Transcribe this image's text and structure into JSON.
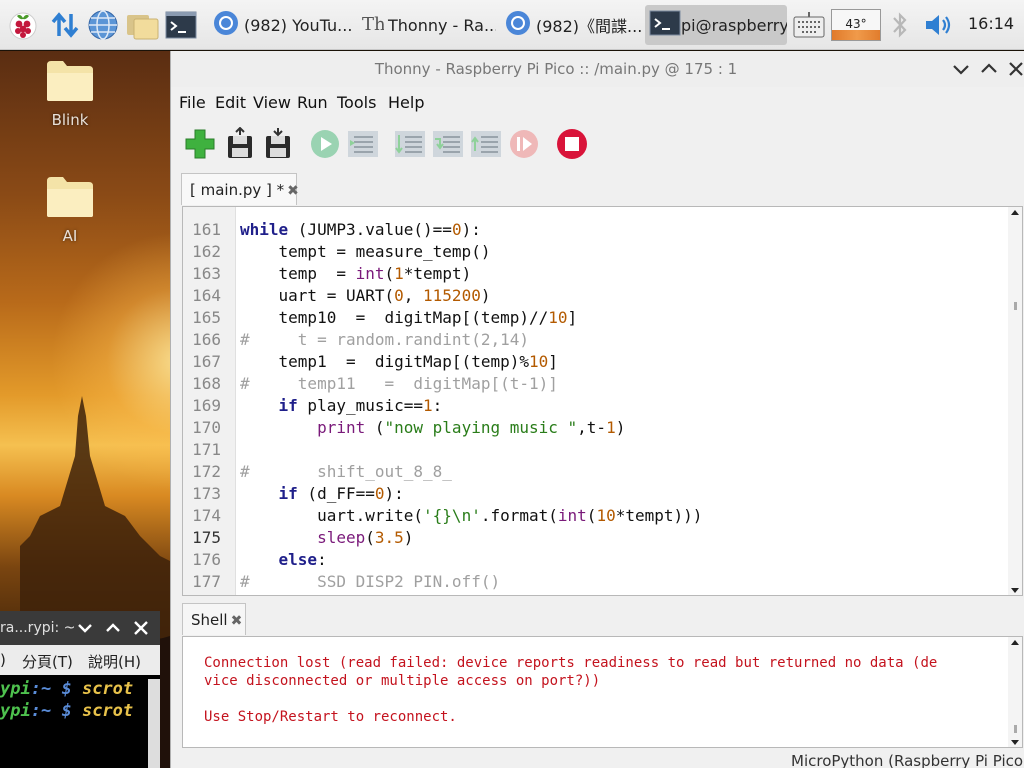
{
  "taskbar": {
    "tasks": [
      {
        "icon": "chromium-icon",
        "label": "(982) YouTu..."
      },
      {
        "icon": "thonny-icon",
        "label": "Thonny  -  Ra..."
      },
      {
        "icon": "chromium-icon",
        "label": "(982)《間諜..."
      },
      {
        "icon": "terminal-icon",
        "label": "pi@raspberry..."
      }
    ],
    "cpu_temp": "43°",
    "clock": "16:14"
  },
  "desktop": {
    "icons": [
      {
        "label": "Blink"
      },
      {
        "label": "AI"
      }
    ]
  },
  "terminal": {
    "title": "ra...rypi: ~",
    "menu": [
      ") ",
      "分頁(T)",
      "說明(H)"
    ],
    "lines": [
      {
        "prompt_host": "ypi",
        "path": ":~",
        "dollar": "$",
        "cmd": "scrot"
      },
      {
        "prompt_host": "ypi",
        "path": ":~",
        "dollar": "$",
        "cmd": "scrot"
      }
    ]
  },
  "thonny": {
    "title": "Thonny  -  Raspberry Pi Pico :: /main.py  @  175 : 1",
    "menu": [
      "File",
      "Edit",
      "View",
      "Run",
      "Tools",
      "Help"
    ],
    "toolbar": [
      {
        "icon": "new-file-icon",
        "enabled": true
      },
      {
        "icon": "open-file-icon",
        "enabled": true
      },
      {
        "icon": "save-file-icon",
        "enabled": true
      },
      {
        "icon": "run-icon",
        "enabled": false
      },
      {
        "icon": "debug-icon",
        "enabled": false
      },
      {
        "icon": "step-over-icon",
        "enabled": false
      },
      {
        "icon": "step-into-icon",
        "enabled": false
      },
      {
        "icon": "step-out-icon",
        "enabled": false
      },
      {
        "icon": "resume-icon",
        "enabled": false
      },
      {
        "icon": "stop-icon",
        "enabled": true
      }
    ],
    "editor_tab": {
      "label": "[ main.py ] *",
      "close": "✖"
    },
    "editor": {
      "current_line": 175,
      "lines": [
        {
          "n": "161",
          "t": "while (JUMP3.value()==0):"
        },
        {
          "n": "162",
          "t": "    tempt = measure_temp()"
        },
        {
          "n": "163",
          "t": "    temp  = int(1*tempt)"
        },
        {
          "n": "164",
          "t": "    uart = UART(0, 115200)"
        },
        {
          "n": "165",
          "t": "    temp10  =  digitMap[(temp)//10]"
        },
        {
          "n": "166",
          "t": "#     t = random.randint(2,14)"
        },
        {
          "n": "167",
          "t": "    temp1  =  digitMap[(temp)%10]"
        },
        {
          "n": "168",
          "t": "#     temp11   =  digitMap[(t-1)]"
        },
        {
          "n": "169",
          "t": "    if play_music==1:"
        },
        {
          "n": "170",
          "t": "        print (\"now playing music \",t-1)"
        },
        {
          "n": "171",
          "t": ""
        },
        {
          "n": "172",
          "t": "#       shift_out_8_8_"
        },
        {
          "n": "173",
          "t": "    if (d_FF==0):"
        },
        {
          "n": "174",
          "t": "        uart.write('{}\\n'.format(int(10*tempt)))"
        },
        {
          "n": "175",
          "t": "        sleep(3.5)"
        },
        {
          "n": "176",
          "t": "    else:"
        },
        {
          "n": "177",
          "t": "#       SSD DISP2 PIN.off()"
        }
      ]
    },
    "shell_tab": {
      "label": "Shell",
      "close": "✖"
    },
    "shell": {
      "lines": [
        "Connection lost (read failed: device reports readiness to read but returned no data (de",
        "vice disconnected or multiple access on port?))",
        "",
        "Use Stop/Restart to reconnect."
      ]
    },
    "status": "MicroPython (Raspberry Pi Pico)"
  },
  "colors": {
    "keyword": "#1f1f8a",
    "number": "#b35a00",
    "string": "#2a7d1a",
    "comment": "#a0a0a0",
    "shell_error": "#c4131e",
    "stop_button": "#d9143a",
    "run_disabled": "#7fc8a0"
  }
}
